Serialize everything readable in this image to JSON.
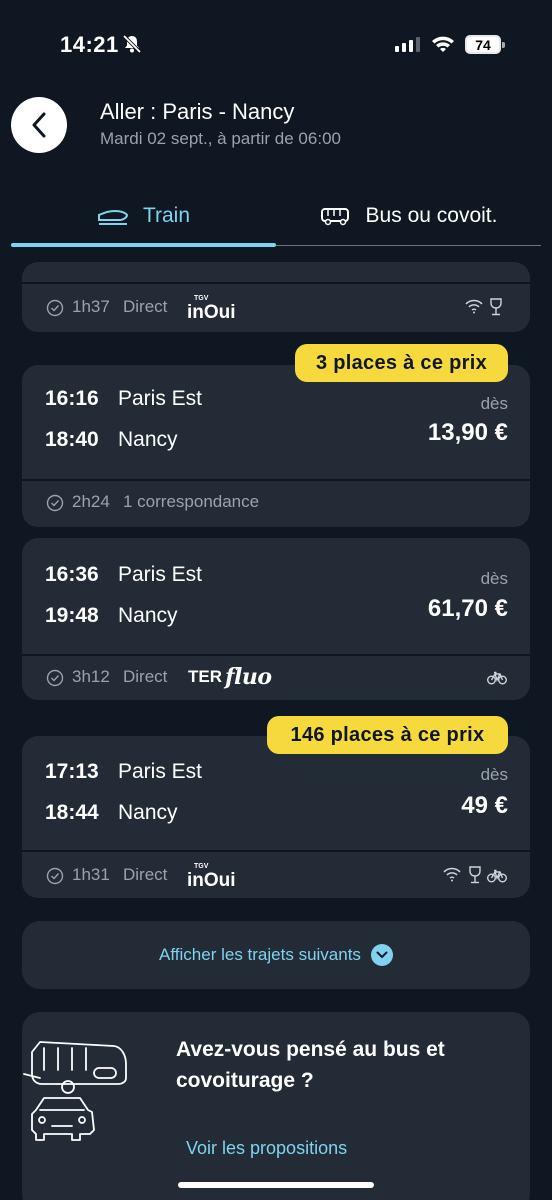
{
  "status_bar": {
    "time": "14:21",
    "battery": "74"
  },
  "header": {
    "title": "Aller : Paris - Nancy",
    "subtitle": "Mardi 02 sept., à partir de 06:00"
  },
  "tabs": [
    {
      "label": "Train",
      "active": true
    },
    {
      "label": "Bus ou covoit.",
      "active": false
    }
  ],
  "journeys": [
    {
      "partial": true,
      "duration": "1h37",
      "type": "Direct",
      "brand": "TGV inOui",
      "amenities": [
        "wifi-icon",
        "wine-glass-icon"
      ]
    },
    {
      "badge": "3 places à ce prix",
      "departure_time": "16:16",
      "departure_station": "Paris Est",
      "arrival_time": "18:40",
      "arrival_station": "Nancy",
      "from_label": "dès",
      "price": "13,90 €",
      "duration": "2h24",
      "type": "1 correspondance"
    },
    {
      "departure_time": "16:36",
      "departure_station": "Paris Est",
      "arrival_time": "19:48",
      "arrival_station": "Nancy",
      "from_label": "dès",
      "price": "61,70 €",
      "duration": "3h12",
      "type": "Direct",
      "brand_ter": "TER",
      "brand_fluo": "fluo",
      "amenities": [
        "bike-icon"
      ]
    },
    {
      "badge": "146 places à ce prix",
      "departure_time": "17:13",
      "departure_station": "Paris Est",
      "arrival_time": "18:44",
      "arrival_station": "Nancy",
      "from_label": "dès",
      "price": "49 €",
      "duration": "1h31",
      "type": "Direct",
      "brand": "TGV inOui",
      "amenities": [
        "wifi-icon",
        "wine-glass-icon",
        "bike-icon"
      ]
    }
  ],
  "more_button": {
    "label": "Afficher les trajets suivants"
  },
  "promo": {
    "text": "Avez-vous pensé au bus et covoiturage ?",
    "link": "Voir les propositions"
  },
  "colors": {
    "accent": "#7fd3ef",
    "badge": "#f6d93c",
    "card": "#232b36",
    "background": "#0f1722"
  }
}
